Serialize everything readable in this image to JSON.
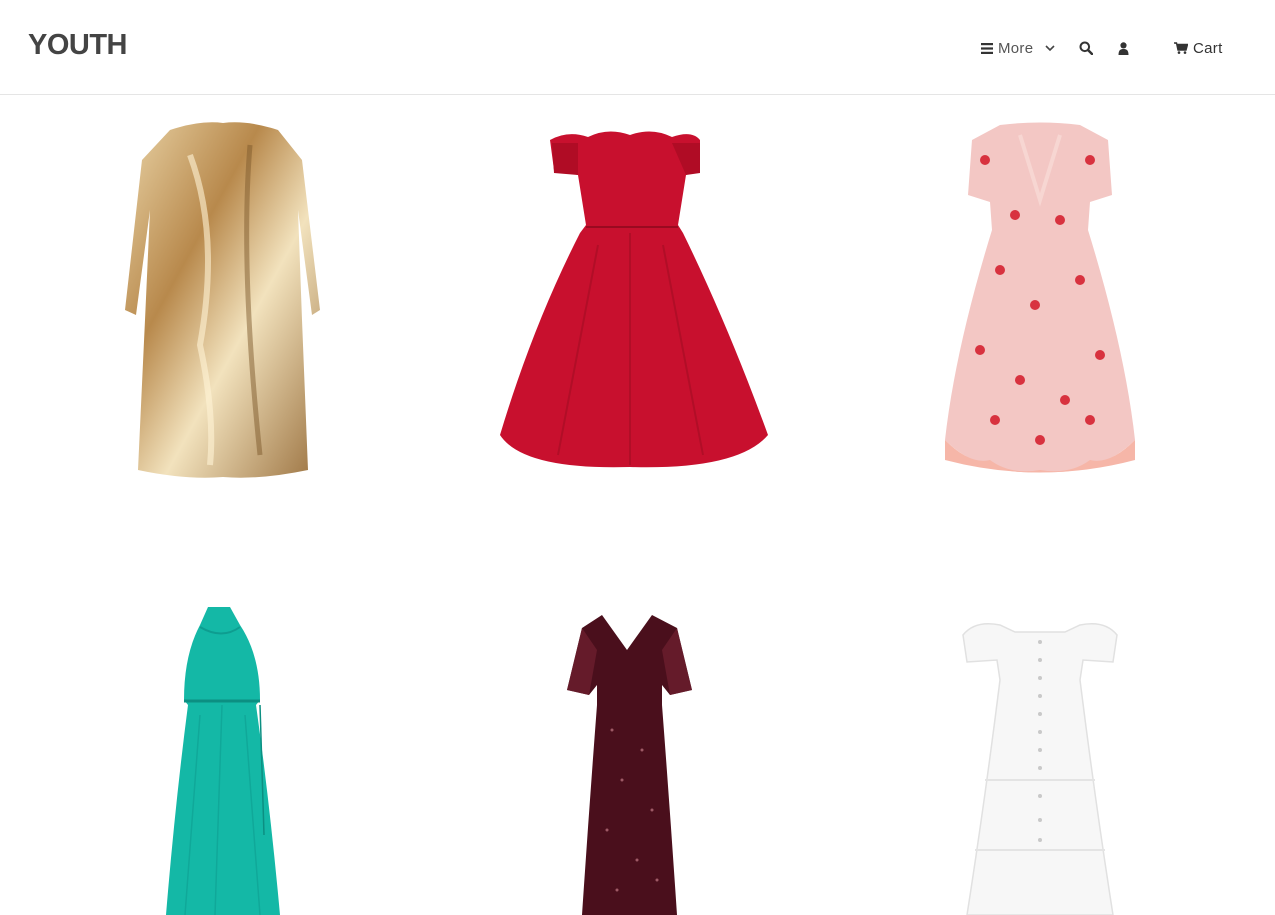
{
  "header": {
    "logo": "YOUTH",
    "nav": {
      "more_label": "More",
      "cart_label": "Cart"
    },
    "icons": [
      "menu-icon",
      "chevron-down-icon",
      "search-icon",
      "user-icon",
      "cart-icon"
    ]
  },
  "products": [
    {
      "name": "gold-sequin-dress",
      "color": "#c9a46a"
    },
    {
      "name": "red-off-shoulder-dress",
      "color": "#c8102e"
    },
    {
      "name": "pink-strawberry-tulle-dress",
      "color": "#f3c7c4"
    },
    {
      "name": "teal-halter-maxi-dress",
      "color": "#14b8a6"
    },
    {
      "name": "burgundy-sequin-gown",
      "color": "#4a0f1c"
    },
    {
      "name": "white-puff-sleeve-dress",
      "color": "#f7f7f7"
    }
  ]
}
